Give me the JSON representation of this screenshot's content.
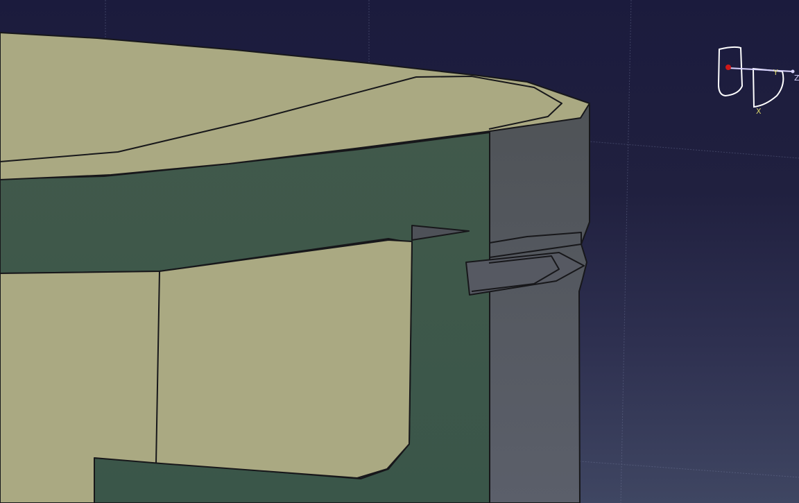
{
  "app": {
    "view": "3D viewport"
  },
  "colors": {
    "background_top": "#1b1b3d",
    "background_bottom": "#3f4662",
    "grid": "#7f86a8",
    "model_green": "#3d5a4b",
    "model_tan": "#aaaa82",
    "model_gray": "#545862",
    "model_edge": "#17171a",
    "compass_outline": "#ffffff",
    "compass_axis_x": "#d3cf69",
    "compass_axis_y": "#d3cf69",
    "compass_axis_z": "#d9d4ff",
    "compass_origin": "#d01818"
  },
  "compass": {
    "axes": {
      "x": "X",
      "y": "Y",
      "z": "Z"
    }
  }
}
